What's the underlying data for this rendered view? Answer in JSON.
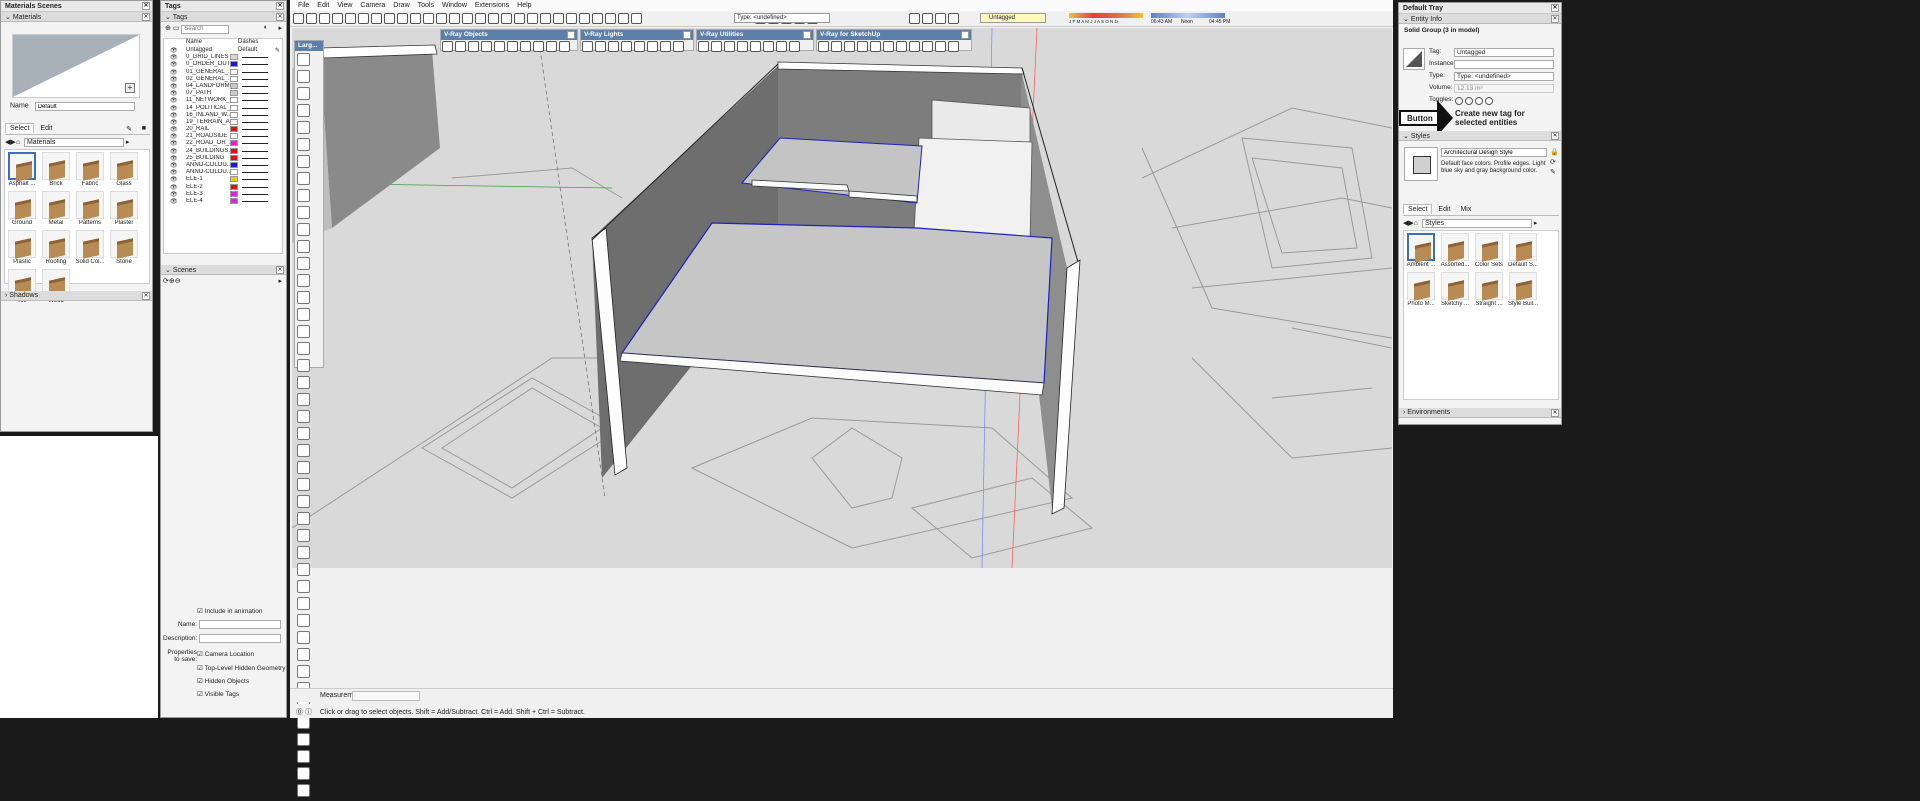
{
  "materials_panel": {
    "title": "Materials Scenes",
    "section_label": "Materials",
    "name_label": "Name",
    "name_value": "Default",
    "tab_select": "Select",
    "tab_edit": "Edit",
    "collection": "Materials",
    "swatches": [
      "Asphalt ...",
      "Brick",
      "Fabric",
      "Glass",
      "Ground",
      "Metal",
      "Patterns",
      "Plaster",
      "Plastic",
      "Roofing",
      "Solid Col...",
      "Stone",
      "Tile",
      "Wood"
    ],
    "shadows": "Shadows"
  },
  "tags_panel": {
    "title": "Tags",
    "section_label": "Tags",
    "search_placeholder": "Search",
    "col_name": "Name",
    "col_dashes": "Dashes",
    "untagged": "Untagged",
    "untagged_dash": "Default",
    "rows": [
      {
        "name": "0_GRID_LINES",
        "color": "#d6d6d6"
      },
      {
        "name": "0_ORDER_OUT...",
        "color": "#1a1ad8"
      },
      {
        "name": "01_GENERAL_...",
        "color": "#ffffff"
      },
      {
        "name": "02_GENERAL_...",
        "color": "#ffffff"
      },
      {
        "name": "04_LANDFORM",
        "color": "#c8c8c8"
      },
      {
        "name": "07_PATH",
        "color": "#c8c8c8"
      },
      {
        "name": "11_NETWORK_...",
        "color": "#ffffff"
      },
      {
        "name": "14_POLITICAL_...",
        "color": "#ffffff"
      },
      {
        "name": "16_INLAND_W...",
        "color": "#ffffff"
      },
      {
        "name": "19_TERRAIN_A...",
        "color": "#ffffff"
      },
      {
        "name": "20_RAIL",
        "color": "#e01010"
      },
      {
        "name": "21_ROADSIDE",
        "color": "#ffffff"
      },
      {
        "name": "22_ROAD_OR_...",
        "color": "#e020e0"
      },
      {
        "name": "24_BUILDINGS...",
        "color": "#e01010"
      },
      {
        "name": "25_BUILDING",
        "color": "#e01010"
      },
      {
        "name": "ANNO-COLOU...",
        "color": "#1a1ad8"
      },
      {
        "name": "ANNO-COLOU...",
        "color": "#ffffff"
      },
      {
        "name": "ELE-1",
        "color": "#e8d000"
      },
      {
        "name": "ELE-2",
        "color": "#e01010"
      },
      {
        "name": "ELE-3",
        "color": "#e020e0"
      },
      {
        "name": "ELE-4",
        "color": "#e020e0"
      }
    ],
    "scenes_label": "Scenes",
    "include_animation": "Include in animation",
    "name_label": "Name:",
    "description_label": "Description:",
    "properties_label": "Properties to save:",
    "props": [
      "Camera Location",
      "Top-Level Hidden Geometry",
      "Hidden Objects",
      "Visible Tags"
    ]
  },
  "menu": [
    "File",
    "Edit",
    "View",
    "Camera",
    "Draw",
    "Tools",
    "Window",
    "Extensions",
    "Help"
  ],
  "toolbar": {
    "type_select": "Type: <undefined>",
    "tag_select": "Untagged",
    "time_left": "06:43 AM",
    "time_mid": "Noon",
    "time_right": "04:45 PM",
    "months": "J F M A M J J A S O N D"
  },
  "float_toolbars": {
    "large": "Larg...",
    "vray_objects": "V-Ray Objects",
    "vray_lights": "V-Ray Lights",
    "vray_utilities": "V-Ray Utilities",
    "vray_sketchup": "V-Ray for SketchUp"
  },
  "statusbar": {
    "measurements": "Measurements",
    "status": "Click or drag to select objects. Shift = Add/Subtract. Ctrl = Add. Shift + Ctrl = Subtract."
  },
  "tray": {
    "title": "Default Tray",
    "entity_info": "Entity Info",
    "entity_title": "Solid Group (3 in model)",
    "tag_label": "Tag:",
    "tag_value": "Untagged",
    "instance_label": "Instance:",
    "type_label": "Type:",
    "type_value": "Type: <undefined>",
    "volume_label": "Volume:",
    "volume_value": "12.13 m³",
    "toggles_label": "Toggles:",
    "callout_button": "Button",
    "callout_text": "Create new tag for selected entities",
    "styles": "Styles",
    "style_name": "Architectural Design Style",
    "style_desc": "Default face colors. Profile edges. Light blue sky and gray background color.",
    "tab_select": "Select",
    "tab_edit": "Edit",
    "tab_mix": "Mix",
    "collection": "Styles",
    "style_items": [
      "Ambient ...",
      "Assorted...",
      "Color Sets",
      "Default S...",
      "Photo M...",
      "Sketchy ...",
      "Straight ...",
      "Style Buil..."
    ],
    "environments": "Environments"
  }
}
